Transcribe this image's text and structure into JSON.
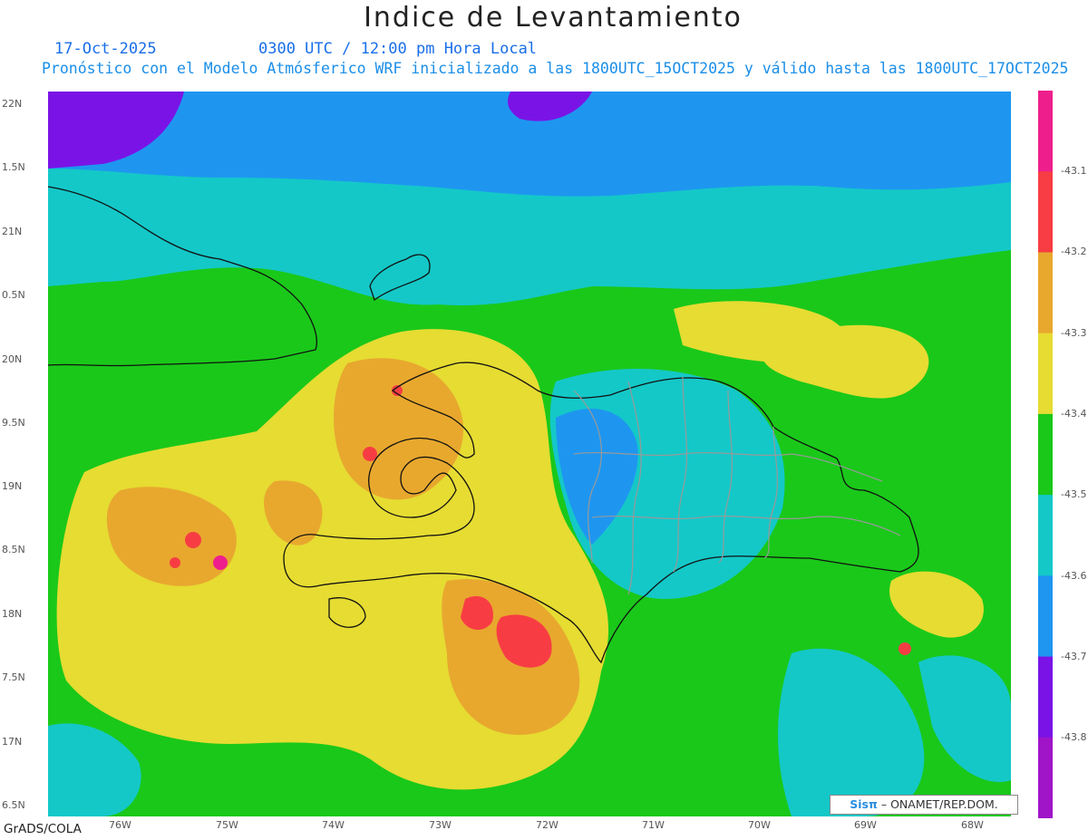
{
  "title": "Indice de Levantamiento",
  "date": "17-Oct-2025",
  "time": "0300 UTC / 12:00 pm Hora Local",
  "description": "Pronóstico con el Modelo Atmósferico WRF inicializado a las 1800UTC_15OCT2025 y válido hasta las  1800UTC_17OCT2025",
  "lat_labels": [
    "22N",
    "1.5N",
    "21N",
    "0.5N",
    "20N",
    "9.5N",
    "19N",
    "8.5N",
    "18N",
    "7.5N",
    "17N",
    "6.5N"
  ],
  "lon_labels": [
    "76W",
    "75W",
    "74W",
    "73W",
    "72W",
    "71W",
    "70W",
    "69W",
    "68W"
  ],
  "colorbar": {
    "labels": [
      "-43.1",
      "-43.2",
      "-43.3",
      "-43.4",
      "-43.5",
      "-43.6",
      "-43.7",
      "-43.8"
    ],
    "colors": [
      "#ee1f8c",
      "#f73d43",
      "#e8a82e",
      "#e6dc32",
      "#1ac81a",
      "#14c8c8",
      "#1e96f0",
      "#7a14e6",
      "#a014c8"
    ]
  },
  "credit": {
    "logo": "Sisπ",
    "text": "– ONAMET/REP.DOM."
  },
  "footer": "GrADS/COLA"
}
